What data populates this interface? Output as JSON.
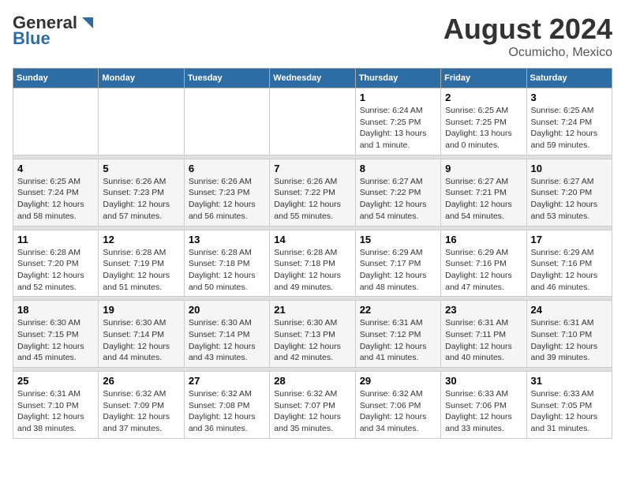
{
  "header": {
    "logo_general": "General",
    "logo_blue": "Blue",
    "title": "August 2024",
    "subtitle": "Ocumicho, Mexico"
  },
  "days_of_week": [
    "Sunday",
    "Monday",
    "Tuesday",
    "Wednesday",
    "Thursday",
    "Friday",
    "Saturday"
  ],
  "weeks": [
    {
      "bg": "white",
      "days": [
        {
          "num": "",
          "info": ""
        },
        {
          "num": "",
          "info": ""
        },
        {
          "num": "",
          "info": ""
        },
        {
          "num": "",
          "info": ""
        },
        {
          "num": "1",
          "info": "Sunrise: 6:24 AM\nSunset: 7:25 PM\nDaylight: 13 hours\nand 1 minute."
        },
        {
          "num": "2",
          "info": "Sunrise: 6:25 AM\nSunset: 7:25 PM\nDaylight: 13 hours\nand 0 minutes."
        },
        {
          "num": "3",
          "info": "Sunrise: 6:25 AM\nSunset: 7:24 PM\nDaylight: 12 hours\nand 59 minutes."
        }
      ]
    },
    {
      "bg": "alt",
      "days": [
        {
          "num": "4",
          "info": "Sunrise: 6:25 AM\nSunset: 7:24 PM\nDaylight: 12 hours\nand 58 minutes."
        },
        {
          "num": "5",
          "info": "Sunrise: 6:26 AM\nSunset: 7:23 PM\nDaylight: 12 hours\nand 57 minutes."
        },
        {
          "num": "6",
          "info": "Sunrise: 6:26 AM\nSunset: 7:23 PM\nDaylight: 12 hours\nand 56 minutes."
        },
        {
          "num": "7",
          "info": "Sunrise: 6:26 AM\nSunset: 7:22 PM\nDaylight: 12 hours\nand 55 minutes."
        },
        {
          "num": "8",
          "info": "Sunrise: 6:27 AM\nSunset: 7:22 PM\nDaylight: 12 hours\nand 54 minutes."
        },
        {
          "num": "9",
          "info": "Sunrise: 6:27 AM\nSunset: 7:21 PM\nDaylight: 12 hours\nand 54 minutes."
        },
        {
          "num": "10",
          "info": "Sunrise: 6:27 AM\nSunset: 7:20 PM\nDaylight: 12 hours\nand 53 minutes."
        }
      ]
    },
    {
      "bg": "white",
      "days": [
        {
          "num": "11",
          "info": "Sunrise: 6:28 AM\nSunset: 7:20 PM\nDaylight: 12 hours\nand 52 minutes."
        },
        {
          "num": "12",
          "info": "Sunrise: 6:28 AM\nSunset: 7:19 PM\nDaylight: 12 hours\nand 51 minutes."
        },
        {
          "num": "13",
          "info": "Sunrise: 6:28 AM\nSunset: 7:18 PM\nDaylight: 12 hours\nand 50 minutes."
        },
        {
          "num": "14",
          "info": "Sunrise: 6:28 AM\nSunset: 7:18 PM\nDaylight: 12 hours\nand 49 minutes."
        },
        {
          "num": "15",
          "info": "Sunrise: 6:29 AM\nSunset: 7:17 PM\nDaylight: 12 hours\nand 48 minutes."
        },
        {
          "num": "16",
          "info": "Sunrise: 6:29 AM\nSunset: 7:16 PM\nDaylight: 12 hours\nand 47 minutes."
        },
        {
          "num": "17",
          "info": "Sunrise: 6:29 AM\nSunset: 7:16 PM\nDaylight: 12 hours\nand 46 minutes."
        }
      ]
    },
    {
      "bg": "alt",
      "days": [
        {
          "num": "18",
          "info": "Sunrise: 6:30 AM\nSunset: 7:15 PM\nDaylight: 12 hours\nand 45 minutes."
        },
        {
          "num": "19",
          "info": "Sunrise: 6:30 AM\nSunset: 7:14 PM\nDaylight: 12 hours\nand 44 minutes."
        },
        {
          "num": "20",
          "info": "Sunrise: 6:30 AM\nSunset: 7:14 PM\nDaylight: 12 hours\nand 43 minutes."
        },
        {
          "num": "21",
          "info": "Sunrise: 6:30 AM\nSunset: 7:13 PM\nDaylight: 12 hours\nand 42 minutes."
        },
        {
          "num": "22",
          "info": "Sunrise: 6:31 AM\nSunset: 7:12 PM\nDaylight: 12 hours\nand 41 minutes."
        },
        {
          "num": "23",
          "info": "Sunrise: 6:31 AM\nSunset: 7:11 PM\nDaylight: 12 hours\nand 40 minutes."
        },
        {
          "num": "24",
          "info": "Sunrise: 6:31 AM\nSunset: 7:10 PM\nDaylight: 12 hours\nand 39 minutes."
        }
      ]
    },
    {
      "bg": "white",
      "days": [
        {
          "num": "25",
          "info": "Sunrise: 6:31 AM\nSunset: 7:10 PM\nDaylight: 12 hours\nand 38 minutes."
        },
        {
          "num": "26",
          "info": "Sunrise: 6:32 AM\nSunset: 7:09 PM\nDaylight: 12 hours\nand 37 minutes."
        },
        {
          "num": "27",
          "info": "Sunrise: 6:32 AM\nSunset: 7:08 PM\nDaylight: 12 hours\nand 36 minutes."
        },
        {
          "num": "28",
          "info": "Sunrise: 6:32 AM\nSunset: 7:07 PM\nDaylight: 12 hours\nand 35 minutes."
        },
        {
          "num": "29",
          "info": "Sunrise: 6:32 AM\nSunset: 7:06 PM\nDaylight: 12 hours\nand 34 minutes."
        },
        {
          "num": "30",
          "info": "Sunrise: 6:33 AM\nSunset: 7:06 PM\nDaylight: 12 hours\nand 33 minutes."
        },
        {
          "num": "31",
          "info": "Sunrise: 6:33 AM\nSunset: 7:05 PM\nDaylight: 12 hours\nand 31 minutes."
        }
      ]
    }
  ]
}
